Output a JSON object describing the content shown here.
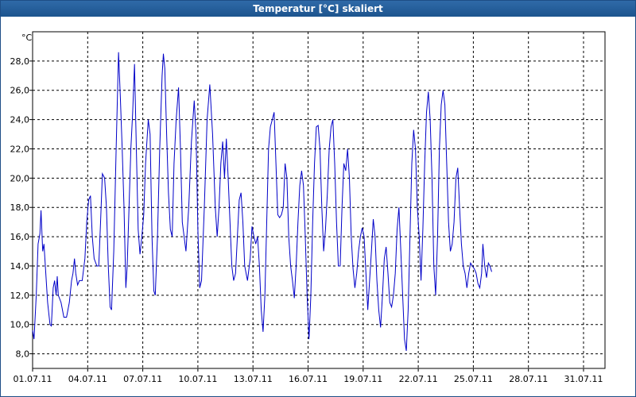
{
  "window": {
    "title": "Temperatur [°C] skaliert"
  },
  "chart_data": {
    "type": "line",
    "title": "Temperatur [°C] skaliert",
    "y_unit": "°C",
    "xlabel": "",
    "ylabel": "",
    "x_range": [
      "01.07.11",
      "01.08.11"
    ],
    "ylim": [
      7,
      30
    ],
    "y_ticks": [
      "8,0",
      "10,0",
      "12,0",
      "14,0",
      "16,0",
      "18,0",
      "20,0",
      "22,0",
      "24,0",
      "26,0",
      "28,0"
    ],
    "x_ticks": [
      "01.07.11",
      "04.07.11",
      "07.07.11",
      "10.07.11",
      "13.07.11",
      "16.07.11",
      "19.07.11",
      "22.07.11",
      "25.07.11",
      "28.07.11",
      "31.07.11"
    ],
    "grid": true,
    "colors": {
      "line": "#0000c8",
      "grid": "#000000"
    },
    "series": [
      {
        "values": [
          [
            0.0,
            9.6
          ],
          [
            0.08,
            9.0
          ],
          [
            0.2,
            12.0
          ],
          [
            0.3,
            15.5
          ],
          [
            0.4,
            16.2
          ],
          [
            0.46,
            17.8
          ],
          [
            0.55,
            15.0
          ],
          [
            0.62,
            15.5
          ],
          [
            0.72,
            13.5
          ],
          [
            0.82,
            11.5
          ],
          [
            0.95,
            10.0
          ],
          [
            1.02,
            9.9
          ],
          [
            1.12,
            12.5
          ],
          [
            1.2,
            13.0
          ],
          [
            1.28,
            12.0
          ],
          [
            1.34,
            13.3
          ],
          [
            1.4,
            12.0
          ],
          [
            1.55,
            11.5
          ],
          [
            1.7,
            10.5
          ],
          [
            1.85,
            10.5
          ],
          [
            2.0,
            11.5
          ],
          [
            2.12,
            13.0
          ],
          [
            2.2,
            13.5
          ],
          [
            2.28,
            14.5
          ],
          [
            2.35,
            13.5
          ],
          [
            2.45,
            12.7
          ],
          [
            2.55,
            13.0
          ],
          [
            2.7,
            13.0
          ],
          [
            2.85,
            14.5
          ],
          [
            2.95,
            17.0
          ],
          [
            3.05,
            18.5
          ],
          [
            3.15,
            18.8
          ],
          [
            3.25,
            16.0
          ],
          [
            3.35,
            14.5
          ],
          [
            3.5,
            14.0
          ],
          [
            3.6,
            14.0
          ],
          [
            3.7,
            17.0
          ],
          [
            3.8,
            20.3
          ],
          [
            3.92,
            20.0
          ],
          [
            4.02,
            18.0
          ],
          [
            4.12,
            14.0
          ],
          [
            4.22,
            11.2
          ],
          [
            4.3,
            11.0
          ],
          [
            4.42,
            15.0
          ],
          [
            4.55,
            22.0
          ],
          [
            4.68,
            28.6
          ],
          [
            4.78,
            25.5
          ],
          [
            4.88,
            22.0
          ],
          [
            4.98,
            18.0
          ],
          [
            5.08,
            12.5
          ],
          [
            5.15,
            14.0
          ],
          [
            5.25,
            18.0
          ],
          [
            5.35,
            22.0
          ],
          [
            5.45,
            24.5
          ],
          [
            5.55,
            27.8
          ],
          [
            5.65,
            22.0
          ],
          [
            5.75,
            16.5
          ],
          [
            5.85,
            14.8
          ],
          [
            5.95,
            16.0
          ],
          [
            6.05,
            17.5
          ],
          [
            6.15,
            21.0
          ],
          [
            6.3,
            24.0
          ],
          [
            6.4,
            23.0
          ],
          [
            6.5,
            16.0
          ],
          [
            6.6,
            12.3
          ],
          [
            6.68,
            12.0
          ],
          [
            6.8,
            16.0
          ],
          [
            6.92,
            22.0
          ],
          [
            7.05,
            27.0
          ],
          [
            7.12,
            28.5
          ],
          [
            7.2,
            27.5
          ],
          [
            7.3,
            23.0
          ],
          [
            7.4,
            19.0
          ],
          [
            7.5,
            16.5
          ],
          [
            7.6,
            16.0
          ],
          [
            7.7,
            21.0
          ],
          [
            7.82,
            24.0
          ],
          [
            7.95,
            26.2
          ],
          [
            8.05,
            22.0
          ],
          [
            8.15,
            17.0
          ],
          [
            8.25,
            16.0
          ],
          [
            8.35,
            15.0
          ],
          [
            8.5,
            18.0
          ],
          [
            8.65,
            22.5
          ],
          [
            8.8,
            25.3
          ],
          [
            8.9,
            23.0
          ],
          [
            9.0,
            16.5
          ],
          [
            9.1,
            12.5
          ],
          [
            9.2,
            13.0
          ],
          [
            9.35,
            18.0
          ],
          [
            9.5,
            24.0
          ],
          [
            9.65,
            26.4
          ],
          [
            9.8,
            23.0
          ],
          [
            9.95,
            18.0
          ],
          [
            10.05,
            16.0
          ],
          [
            10.15,
            18.0
          ],
          [
            10.25,
            21.0
          ],
          [
            10.35,
            22.5
          ],
          [
            10.45,
            20.0
          ],
          [
            10.55,
            22.7
          ],
          [
            10.65,
            20.0
          ],
          [
            10.75,
            17.0
          ],
          [
            10.85,
            14.0
          ],
          [
            10.95,
            13.0
          ],
          [
            11.05,
            13.5
          ],
          [
            11.15,
            16.0
          ],
          [
            11.25,
            18.5
          ],
          [
            11.35,
            19.0
          ],
          [
            11.45,
            17.0
          ],
          [
            11.55,
            14.0
          ],
          [
            11.7,
            13.0
          ],
          [
            11.85,
            14.5
          ],
          [
            11.95,
            16.7
          ],
          [
            12.05,
            16.0
          ],
          [
            12.15,
            15.5
          ],
          [
            12.25,
            16.0
          ],
          [
            12.35,
            14.0
          ],
          [
            12.45,
            11.0
          ],
          [
            12.55,
            9.5
          ],
          [
            12.65,
            12.0
          ],
          [
            12.75,
            17.0
          ],
          [
            12.85,
            22.0
          ],
          [
            12.95,
            23.5
          ],
          [
            13.05,
            24.0
          ],
          [
            13.15,
            24.5
          ],
          [
            13.25,
            21.0
          ],
          [
            13.35,
            17.5
          ],
          [
            13.45,
            17.3
          ],
          [
            13.55,
            17.5
          ],
          [
            13.65,
            18.0
          ],
          [
            13.75,
            21.0
          ],
          [
            13.85,
            20.0
          ],
          [
            13.95,
            16.0
          ],
          [
            14.05,
            14.0
          ],
          [
            14.15,
            13.0
          ],
          [
            14.25,
            11.8
          ],
          [
            14.35,
            14.0
          ],
          [
            14.45,
            17.0
          ],
          [
            14.55,
            19.5
          ],
          [
            14.65,
            20.5
          ],
          [
            14.75,
            19.5
          ],
          [
            14.85,
            16.0
          ],
          [
            14.95,
            12.0
          ],
          [
            15.05,
            9.0
          ],
          [
            15.15,
            12.0
          ],
          [
            15.25,
            17.0
          ],
          [
            15.35,
            21.0
          ],
          [
            15.45,
            23.5
          ],
          [
            15.55,
            23.6
          ],
          [
            15.65,
            22.0
          ],
          [
            15.75,
            18.0
          ],
          [
            15.85,
            15.0
          ],
          [
            15.95,
            16.5
          ],
          [
            16.05,
            19.0
          ],
          [
            16.15,
            22.0
          ],
          [
            16.25,
            23.5
          ],
          [
            16.35,
            24.0
          ],
          [
            16.45,
            21.0
          ],
          [
            16.55,
            17.0
          ],
          [
            16.65,
            14.0
          ],
          [
            16.75,
            14.0
          ],
          [
            16.85,
            18.0
          ],
          [
            16.95,
            21.0
          ],
          [
            17.05,
            20.5
          ],
          [
            17.15,
            22.0
          ],
          [
            17.25,
            20.0
          ],
          [
            17.35,
            16.0
          ],
          [
            17.45,
            13.8
          ],
          [
            17.55,
            12.5
          ],
          [
            17.65,
            13.5
          ],
          [
            17.75,
            15.0
          ],
          [
            17.85,
            16.0
          ],
          [
            17.95,
            16.6
          ],
          [
            18.05,
            16.0
          ],
          [
            18.15,
            13.5
          ],
          [
            18.25,
            11.0
          ],
          [
            18.35,
            13.0
          ],
          [
            18.45,
            15.0
          ],
          [
            18.55,
            17.2
          ],
          [
            18.65,
            16.0
          ],
          [
            18.75,
            13.0
          ],
          [
            18.85,
            11.0
          ],
          [
            18.95,
            9.8
          ],
          [
            19.05,
            12.0
          ],
          [
            19.15,
            14.5
          ],
          [
            19.25,
            15.3
          ],
          [
            19.35,
            13.5
          ],
          [
            19.45,
            11.5
          ],
          [
            19.55,
            11.2
          ],
          [
            19.65,
            12.0
          ],
          [
            19.75,
            13.5
          ],
          [
            19.85,
            16.5
          ],
          [
            19.95,
            18.0
          ],
          [
            20.05,
            15.0
          ],
          [
            20.15,
            12.0
          ],
          [
            20.25,
            9.0
          ],
          [
            20.35,
            8.2
          ],
          [
            20.45,
            11.0
          ],
          [
            20.55,
            16.0
          ],
          [
            20.65,
            21.0
          ],
          [
            20.75,
            23.3
          ],
          [
            20.85,
            22.0
          ],
          [
            20.95,
            18.0
          ],
          [
            21.05,
            16.0
          ],
          [
            21.15,
            13.0
          ],
          [
            21.25,
            16.5
          ],
          [
            21.35,
            21.0
          ],
          [
            21.45,
            24.5
          ],
          [
            21.55,
            25.9
          ],
          [
            21.65,
            24.0
          ],
          [
            21.75,
            20.0
          ],
          [
            21.85,
            14.0
          ],
          [
            21.95,
            12.0
          ],
          [
            22.05,
            16.0
          ],
          [
            22.15,
            22.0
          ],
          [
            22.25,
            25.0
          ],
          [
            22.35,
            26.0
          ],
          [
            22.45,
            25.0
          ],
          [
            22.55,
            21.0
          ],
          [
            22.65,
            17.0
          ],
          [
            22.75,
            15.0
          ],
          [
            22.85,
            15.5
          ],
          [
            22.95,
            17.0
          ],
          [
            23.05,
            20.0
          ],
          [
            23.15,
            20.7
          ],
          [
            23.25,
            18.0
          ],
          [
            23.35,
            15.5
          ],
          [
            23.45,
            14.0
          ],
          [
            23.55,
            13.5
          ],
          [
            23.65,
            12.5
          ],
          [
            23.75,
            13.5
          ],
          [
            23.85,
            14.2
          ],
          [
            23.95,
            14.0
          ],
          [
            24.05,
            13.8
          ],
          [
            24.15,
            13.5
          ],
          [
            24.25,
            12.8
          ],
          [
            24.35,
            12.5
          ],
          [
            24.45,
            13.5
          ],
          [
            24.52,
            15.5
          ],
          [
            24.62,
            14.0
          ],
          [
            24.72,
            13.2
          ],
          [
            24.82,
            14.2
          ],
          [
            24.9,
            14.0
          ],
          [
            25.0,
            13.6
          ]
        ]
      }
    ]
  }
}
